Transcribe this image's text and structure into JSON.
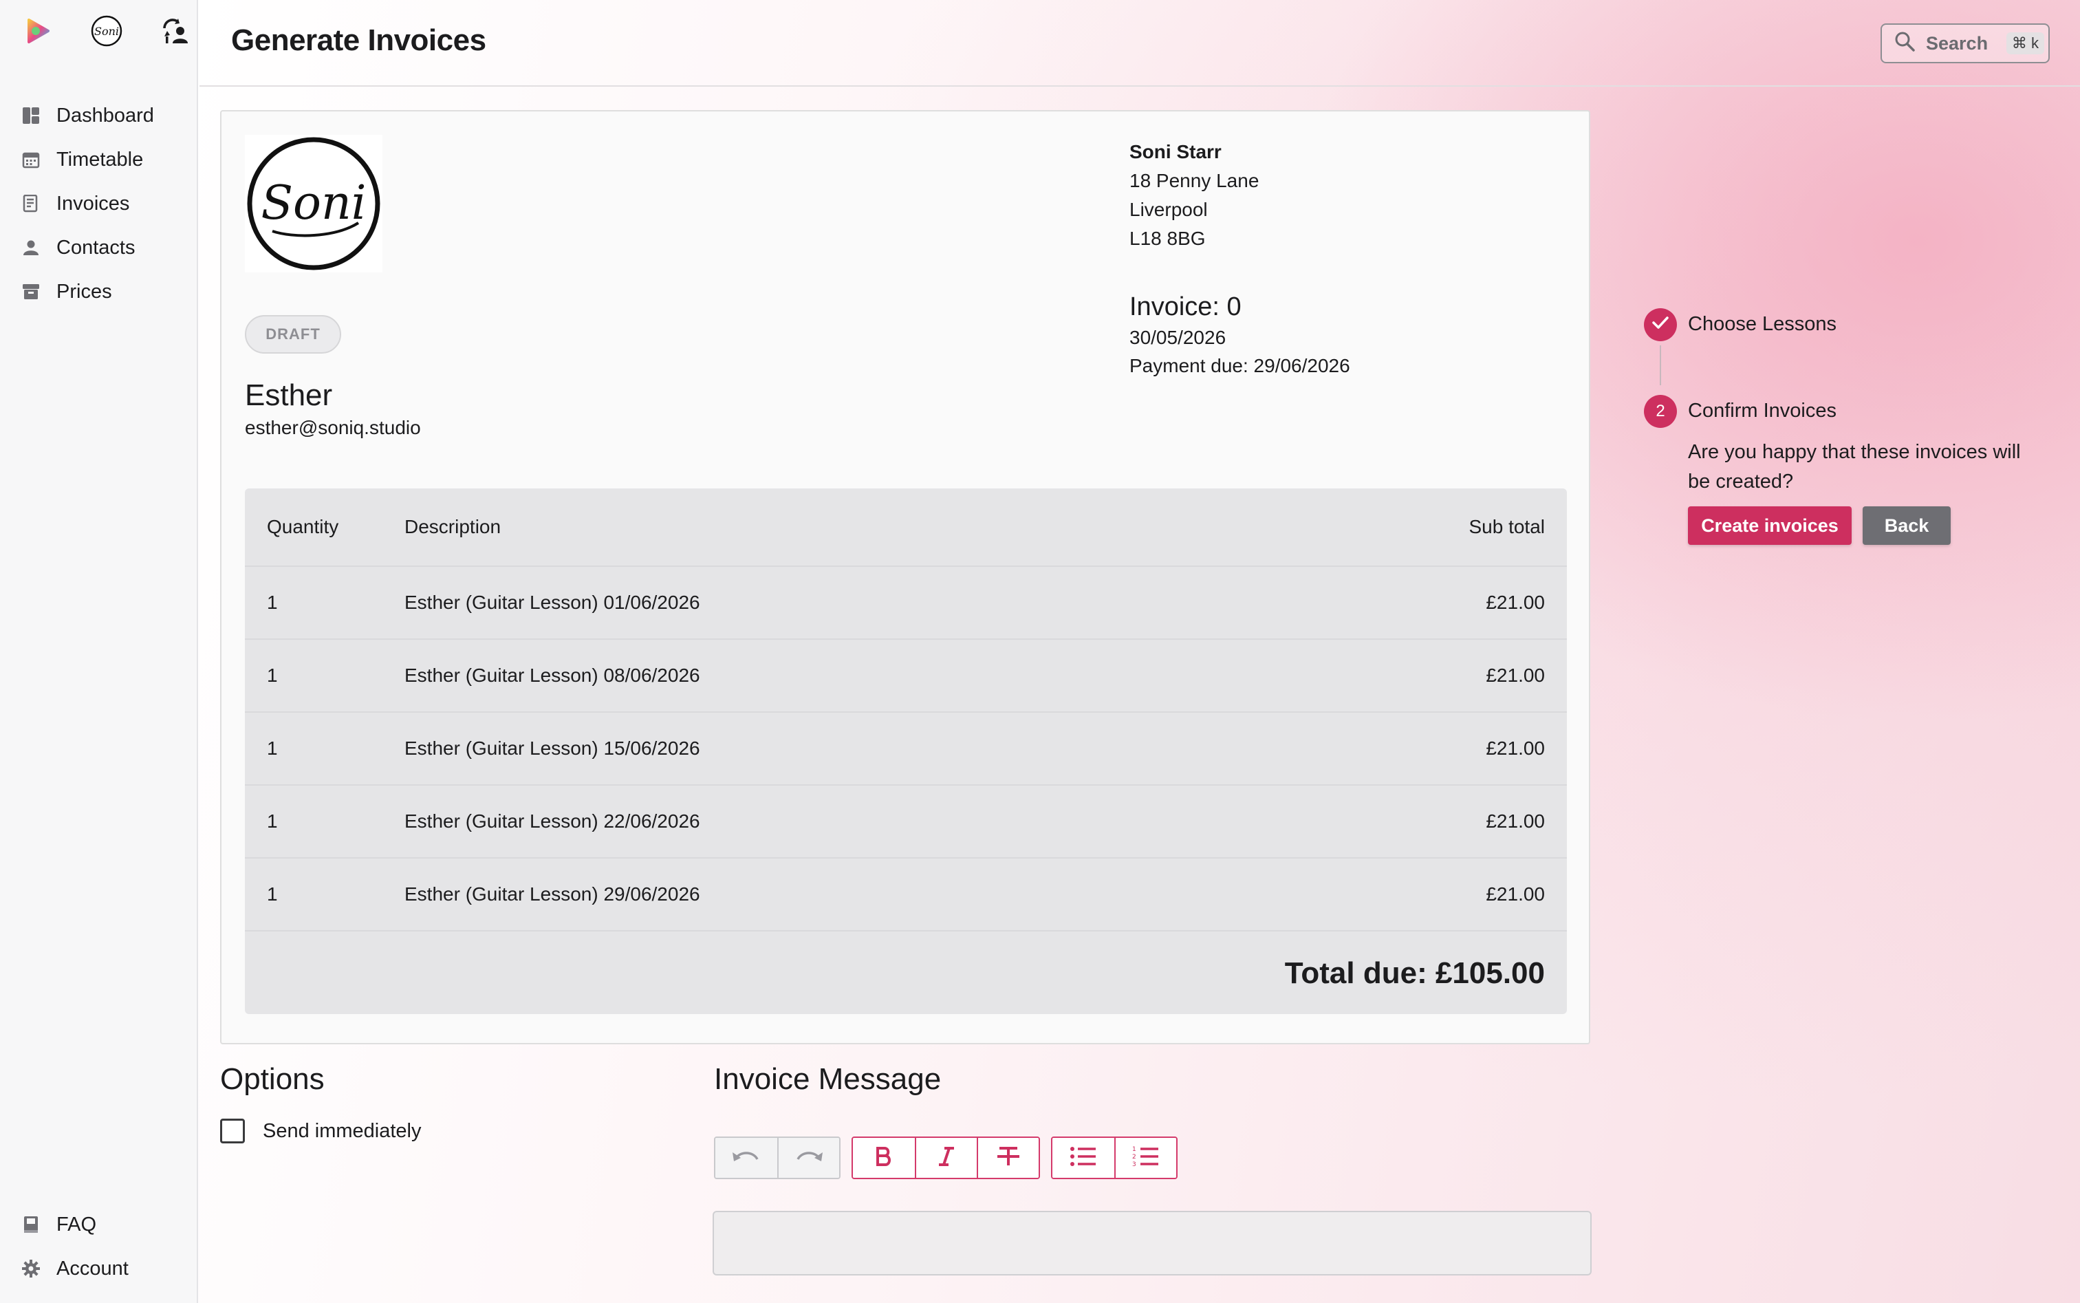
{
  "header": {
    "title": "Generate Invoices",
    "search_label": "Search",
    "search_shortcut": "⌘ k"
  },
  "sidebar": {
    "top_icons": [
      "app-logo-icon",
      "soni-logo-icon",
      "switch-user-icon"
    ],
    "items": [
      {
        "label": "Dashboard",
        "icon": "dashboard-icon"
      },
      {
        "label": "Timetable",
        "icon": "calendar-icon"
      },
      {
        "label": "Invoices",
        "icon": "invoice-icon"
      },
      {
        "label": "Contacts",
        "icon": "user-icon"
      },
      {
        "label": "Prices",
        "icon": "archive-icon"
      }
    ],
    "footer": [
      {
        "label": "FAQ",
        "icon": "book-icon"
      },
      {
        "label": "Account",
        "icon": "gear-icon"
      }
    ]
  },
  "invoice": {
    "logo_text": "Soni",
    "status": "DRAFT",
    "customer_name": "Esther",
    "customer_email": "esther@soniq.studio",
    "from": {
      "name": "Soni Starr",
      "line1": "18 Penny Lane",
      "line2": "Liverpool",
      "line3": "L18 8BG"
    },
    "number_label": "Invoice: 0",
    "date": "30/05/2026",
    "payment_due": "Payment due: 29/06/2026",
    "columns": {
      "quantity": "Quantity",
      "description": "Description",
      "subtotal": "Sub total"
    },
    "rows": [
      {
        "qty": "1",
        "desc": "Esther (Guitar Lesson) 01/06/2026",
        "sub": "£21.00"
      },
      {
        "qty": "1",
        "desc": "Esther (Guitar Lesson) 08/06/2026",
        "sub": "£21.00"
      },
      {
        "qty": "1",
        "desc": "Esther (Guitar Lesson) 15/06/2026",
        "sub": "£21.00"
      },
      {
        "qty": "1",
        "desc": "Esther (Guitar Lesson) 22/06/2026",
        "sub": "£21.00"
      },
      {
        "qty": "1",
        "desc": "Esther (Guitar Lesson) 29/06/2026",
        "sub": "£21.00"
      }
    ],
    "total": "Total due: £105.00"
  },
  "options": {
    "title": "Options",
    "send_immediately_label": "Send immediately",
    "send_immediately_checked": false
  },
  "message": {
    "title": "Invoice Message",
    "toolbar": [
      "undo-icon",
      "redo-icon",
      "bold-icon",
      "italic-icon",
      "strikethrough-icon",
      "bullet-list-icon",
      "numbered-list-icon"
    ],
    "value": ""
  },
  "steps": {
    "step1_label": "Choose Lessons",
    "step2_number": "2",
    "step2_label": "Confirm Invoices",
    "question": "Are you happy that these invoices will be created?",
    "create_button": "Create invoices",
    "back_button": "Back"
  },
  "colors": {
    "accent": "#cd2f5f",
    "secondary_button": "#6e6e73"
  }
}
